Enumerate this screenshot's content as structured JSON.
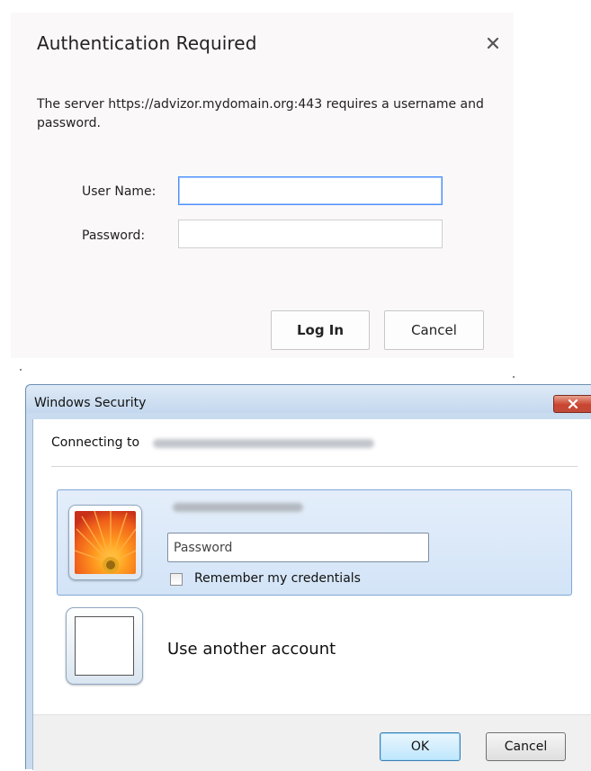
{
  "auth_dialog": {
    "title": "Authentication Required",
    "close_glyph": "×",
    "message": "The server https://advizor.mydomain.org:443 requires a username and password.",
    "username_label": "User Name:",
    "username_value": "",
    "password_label": "Password:",
    "password_value": "",
    "login_label": "Log In",
    "cancel_label": "Cancel",
    "focus_color": "#4d90fe"
  },
  "windows_security": {
    "title": "Windows Security",
    "connecting_prefix": "Connecting to",
    "credential_tile": {
      "avatar_icon": "orange-flower-avatar-icon",
      "password_placeholder": "Password",
      "password_value": "",
      "remember_label": "Remember my credentials",
      "remember_checked": false
    },
    "other_account_label": "Use another account",
    "ok_label": "OK",
    "cancel_label": "Cancel",
    "close_button_color": "#c9452f",
    "selection_color": "#d3e4f7"
  }
}
